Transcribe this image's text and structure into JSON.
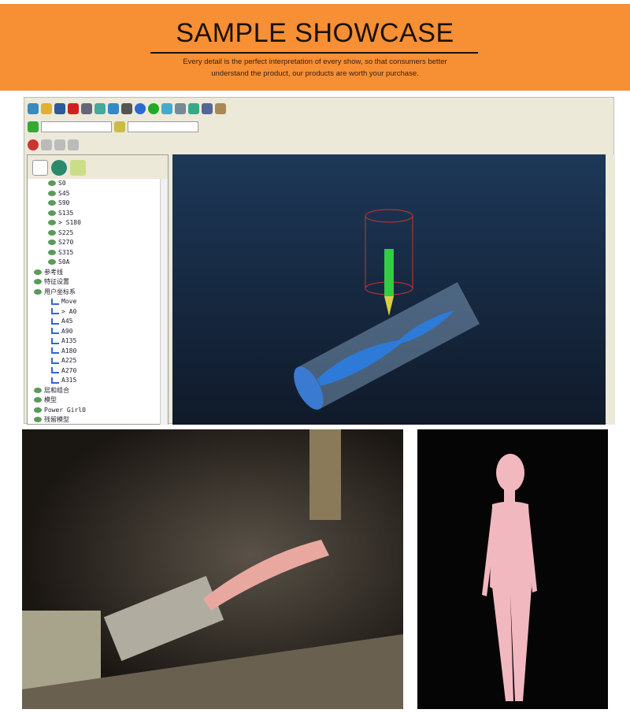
{
  "header": {
    "title": "SAMPLE SHOWCASE",
    "subtitle_line1": "Every detail is the perfect interpretation of every show, so that consumers better",
    "subtitle_line2": "understand the product, our products are worth your purchase."
  },
  "colors": {
    "banner": "#f78f35",
    "viewport": "#1d3858"
  },
  "software": {
    "tree_items": [
      "S0",
      "S45",
      "S90",
      "S135",
      "> S180",
      "S225",
      "S270",
      "S315",
      "S0A",
      "参考线",
      "特征设置",
      "用户坐标系",
      "Move",
      "> A0",
      "A45",
      "A90",
      "A135",
      "A180",
      "A225",
      "A270",
      "A315",
      "层和组合",
      "模型",
      "Power Girl0",
      "残留模型"
    ]
  },
  "photos": {
    "machining": "CNC rotary carving of figure",
    "finished": "pink carved figure"
  }
}
